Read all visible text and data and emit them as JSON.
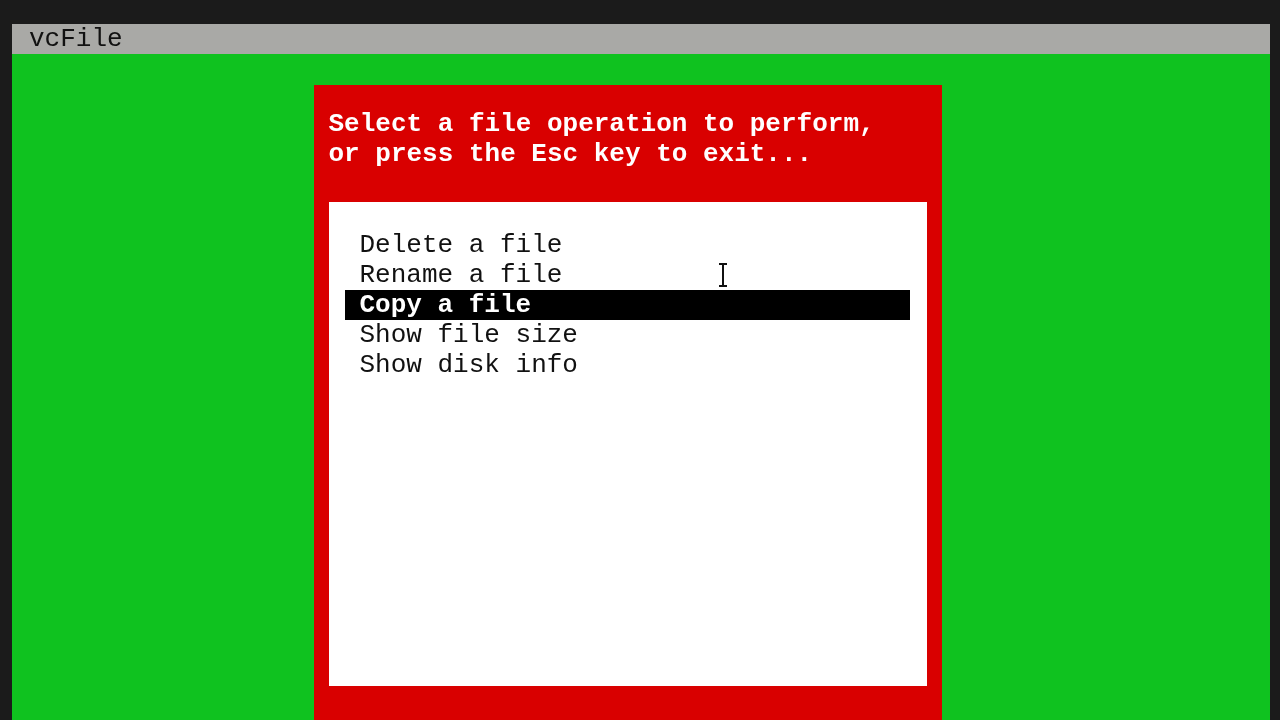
{
  "window": {
    "title": "vcFile"
  },
  "dialog": {
    "prompt_lines": [
      "Select a file operation to perform,",
      "or press the Esc key to exit..."
    ],
    "menu": [
      {
        "label": "Delete a file",
        "selected": false
      },
      {
        "label": "Rename a file",
        "selected": false
      },
      {
        "label": "Copy a file",
        "selected": true
      },
      {
        "label": "Show file size",
        "selected": false
      },
      {
        "label": "Show disk info",
        "selected": false
      }
    ]
  }
}
